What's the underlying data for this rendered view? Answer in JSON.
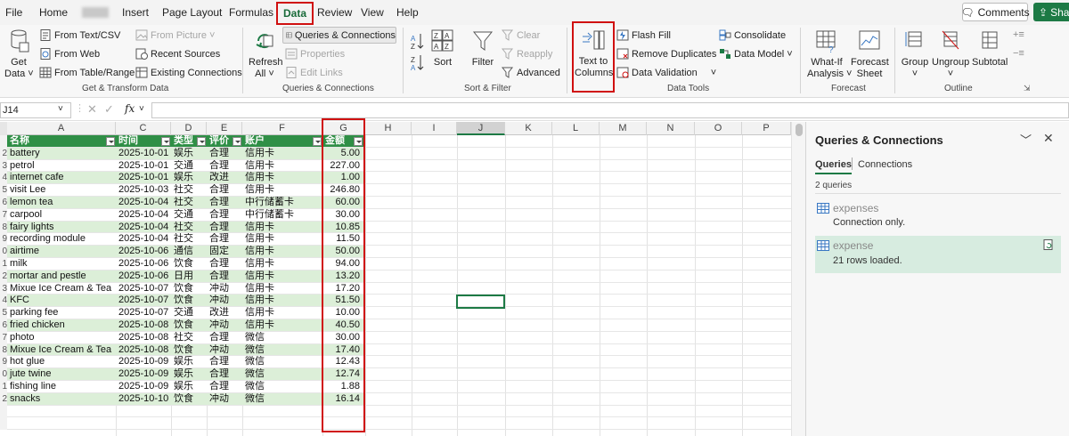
{
  "menu": {
    "items": [
      "File",
      "Home",
      "Insert",
      "Page Layout",
      "Formulas",
      "Data",
      "Review",
      "View",
      "Help"
    ],
    "comments": "Comments",
    "share": "Shar"
  },
  "ribbon": {
    "get_data": {
      "line1": "Get",
      "line2": "Data"
    },
    "from_text_csv": "From Text/CSV",
    "from_web": "From Web",
    "from_table_range": "From Table/Range",
    "from_picture": "From Picture",
    "recent_sources": "Recent Sources",
    "existing_connections": "Existing Connections",
    "group_get_transform": "Get & Transform Data",
    "refresh": {
      "line1": "Refresh",
      "line2": "All"
    },
    "queries_connections": "Queries & Connections",
    "properties": "Properties",
    "edit_links": "Edit Links",
    "group_queries": "Queries & Connections",
    "sort": "Sort",
    "filter": "Filter",
    "clear": "Clear",
    "reapply": "Reapply",
    "advanced": "Advanced",
    "group_sort_filter": "Sort & Filter",
    "text_to_columns": {
      "line1": "Text to",
      "line2": "Columns"
    },
    "flash_fill": "Flash Fill",
    "remove_duplicates": "Remove Duplicates",
    "data_validation": "Data Validation",
    "consolidate": "Consolidate",
    "data_model": "Data Model",
    "group_data_tools": "Data Tools",
    "what_if": {
      "line1": "What-If",
      "line2": "Analysis"
    },
    "forecast_sheet": {
      "line1": "Forecast",
      "line2": "Sheet"
    },
    "group_forecast": "Forecast",
    "group": "Group",
    "ungroup": "Ungroup",
    "subtotal": "Subtotal",
    "group_outline": "Outline"
  },
  "formula_bar": {
    "name_box": "J14",
    "fx": "fx",
    "content": ""
  },
  "sheet": {
    "columns": [
      "A",
      "C",
      "D",
      "E",
      "F",
      "G",
      "H",
      "I",
      "J",
      "K",
      "L",
      "M",
      "N",
      "O",
      "P"
    ],
    "row_numbers": [
      "",
      "2",
      "3",
      "4",
      "5",
      "6",
      "7",
      "8",
      "9",
      "0",
      "1",
      "2",
      "3",
      "4",
      "5",
      "6",
      "7",
      "8",
      "9",
      "0",
      "1",
      "2"
    ],
    "headers": [
      "名称",
      "时间",
      "类型",
      "评价",
      "账户",
      "金额"
    ],
    "rows": [
      [
        "battery",
        "2025-10-01",
        "娱乐",
        "合理",
        "信用卡",
        "5.00"
      ],
      [
        "petrol",
        "2025-10-01",
        "交通",
        "合理",
        "信用卡",
        "227.00"
      ],
      [
        "internet cafe",
        "2025-10-01",
        "娱乐",
        "改进",
        "信用卡",
        "1.00"
      ],
      [
        "visit Lee",
        "2025-10-03",
        "社交",
        "合理",
        "信用卡",
        "246.80"
      ],
      [
        "lemon tea",
        "2025-10-04",
        "社交",
        "合理",
        "中行储蓄卡",
        "60.00"
      ],
      [
        "carpool",
        "2025-10-04",
        "交通",
        "合理",
        "中行储蓄卡",
        "30.00"
      ],
      [
        "fairy lights",
        "2025-10-04",
        "社交",
        "合理",
        "信用卡",
        "10.85"
      ],
      [
        "recording module",
        "2025-10-04",
        "社交",
        "合理",
        "信用卡",
        "11.50"
      ],
      [
        "airtime",
        "2025-10-06",
        "通信",
        "固定",
        "信用卡",
        "50.00"
      ],
      [
        "milk",
        "2025-10-06",
        "饮食",
        "合理",
        "信用卡",
        "94.00"
      ],
      [
        "mortar and pestle",
        "2025-10-06",
        "日用",
        "合理",
        "信用卡",
        "13.20"
      ],
      [
        "Mixue Ice Cream & Tea",
        "2025-10-07",
        "饮食",
        "冲动",
        "信用卡",
        "17.20"
      ],
      [
        "KFC",
        "2025-10-07",
        "饮食",
        "冲动",
        "信用卡",
        "51.50"
      ],
      [
        "parking fee",
        "2025-10-07",
        "交通",
        "改进",
        "信用卡",
        "10.00"
      ],
      [
        "fried chicken",
        "2025-10-08",
        "饮食",
        "冲动",
        "信用卡",
        "40.50"
      ],
      [
        "photo",
        "2025-10-08",
        "社交",
        "合理",
        "微信",
        "30.00"
      ],
      [
        "Mixue Ice Cream & Tea",
        "2025-10-08",
        "饮食",
        "冲动",
        "微信",
        "17.40"
      ],
      [
        "hot glue",
        "2025-10-09",
        "娱乐",
        "合理",
        "微信",
        "12.43"
      ],
      [
        "jute twine",
        "2025-10-09",
        "娱乐",
        "合理",
        "微信",
        "12.74"
      ],
      [
        "fishing line",
        "2025-10-09",
        "娱乐",
        "合理",
        "微信",
        "1.88"
      ],
      [
        "snacks",
        "2025-10-10",
        "饮食",
        "冲动",
        "微信",
        "16.14"
      ]
    ]
  },
  "pane": {
    "title": "Queries & Connections",
    "tab_queries": "Queries",
    "tab_connections": "Connections",
    "count": "2 queries",
    "items": [
      {
        "name": "expenses",
        "desc": "Connection only."
      },
      {
        "name": "expense",
        "desc": "21 rows loaded."
      }
    ]
  },
  "colors": {
    "accent": "#1d7a45",
    "table_header": "#2f8f46",
    "band": "#dcefd8",
    "highlight": "#d01010"
  }
}
